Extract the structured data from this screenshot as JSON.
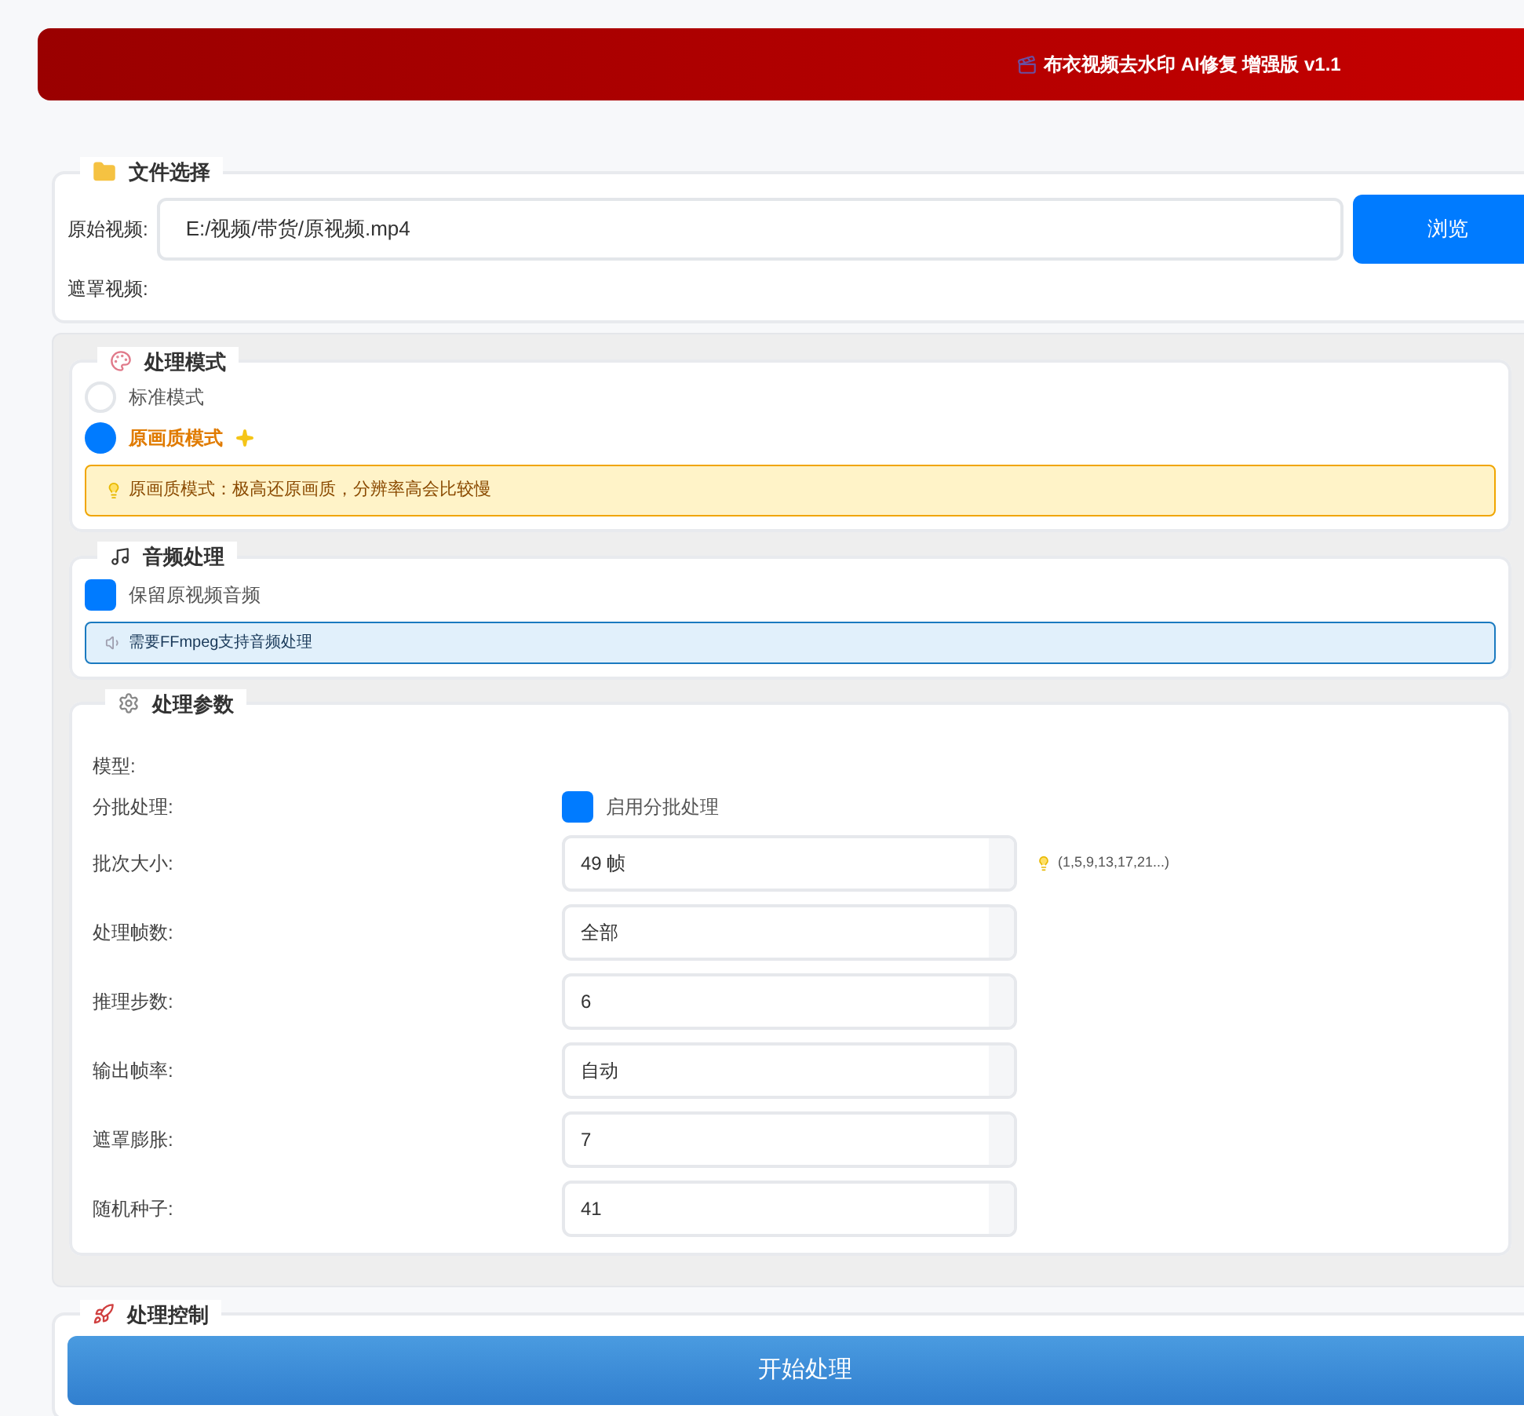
{
  "header": {
    "title": "布衣视频去水印 AI修复 增强版 v1.1"
  },
  "file_section": {
    "title": "文件选择",
    "fields": [
      {
        "label": "原始视频:",
        "value": "E:/视频/带货/原视频.mp4"
      },
      {
        "label": "遮罩视频:"
      }
    ],
    "browse_button": "浏览"
  },
  "mode_section": {
    "title": "处理模式",
    "options": [
      {
        "label": "标准模式",
        "selected": false
      },
      {
        "label": "原画质模式",
        "selected": true
      }
    ],
    "tip": "原画质模式：极高还原画质，分辨率高会比较慢"
  },
  "audio_section": {
    "title": "音频处理",
    "checkbox": {
      "label": "保留原视频音频",
      "checked": true
    },
    "info": "需要FFmpeg支持音频处理"
  },
  "params_section": {
    "title": "处理参数",
    "model_label": "模型:",
    "batch": {
      "label": "分批处理:",
      "checkbox_label": "启用分批处理",
      "checked": true
    },
    "fields": [
      {
        "label": "批次大小:",
        "value": "49 帧",
        "hint": "(1,5,9,13,17,21...)"
      },
      {
        "label": "处理帧数:",
        "value": "全部"
      },
      {
        "label": "推理步数:",
        "value": "6"
      },
      {
        "label": "输出帧率:",
        "value": "自动"
      },
      {
        "label": "遮罩膨胀:",
        "value": "7"
      },
      {
        "label": "随机种子:",
        "value": "41"
      }
    ]
  },
  "control_section": {
    "title": "处理控制",
    "start_button": "开始处理"
  }
}
